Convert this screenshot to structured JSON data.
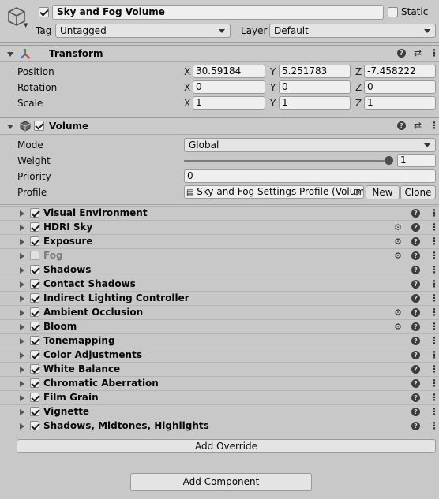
{
  "gameobject": {
    "active": true,
    "name": "Sky and Fog Volume",
    "static_label": "Static",
    "static_checked": false,
    "tag_label": "Tag",
    "tag_value": "Untagged",
    "layer_label": "Layer",
    "layer_value": "Default"
  },
  "transform": {
    "title": "Transform",
    "position_label": "Position",
    "rotation_label": "Rotation",
    "scale_label": "Scale",
    "axis_x": "X",
    "axis_y": "Y",
    "axis_z": "Z",
    "position": {
      "x": "30.59184",
      "y": "5.251783",
      "z": "-7.458222"
    },
    "rotation": {
      "x": "0",
      "y": "0",
      "z": "0"
    },
    "scale": {
      "x": "1",
      "y": "1",
      "z": "1"
    }
  },
  "volume": {
    "title": "Volume",
    "enabled": true,
    "mode_label": "Mode",
    "mode_value": "Global",
    "weight_label": "Weight",
    "weight_value": "1",
    "weight_fraction": 1.0,
    "priority_label": "Priority",
    "priority_value": "0",
    "profile_label": "Profile",
    "profile_value": "Sky and Fog Settings Profile (Volum",
    "new_button": "New",
    "clone_button": "Clone",
    "overrides": [
      {
        "label": "Visual Environment",
        "checked": true,
        "presets": false,
        "disabled": false
      },
      {
        "label": "HDRI Sky",
        "checked": true,
        "presets": true,
        "disabled": false
      },
      {
        "label": "Exposure",
        "checked": true,
        "presets": true,
        "disabled": false
      },
      {
        "label": "Fog",
        "checked": false,
        "presets": true,
        "disabled": true
      },
      {
        "label": "Shadows",
        "checked": true,
        "presets": false,
        "disabled": false
      },
      {
        "label": "Contact Shadows",
        "checked": true,
        "presets": false,
        "disabled": false
      },
      {
        "label": "Indirect Lighting Controller",
        "checked": true,
        "presets": false,
        "disabled": false
      },
      {
        "label": "Ambient Occlusion",
        "checked": true,
        "presets": true,
        "disabled": false
      },
      {
        "label": "Bloom",
        "checked": true,
        "presets": true,
        "disabled": false
      },
      {
        "label": "Tonemapping",
        "checked": true,
        "presets": false,
        "disabled": false
      },
      {
        "label": "Color Adjustments",
        "checked": true,
        "presets": false,
        "disabled": false
      },
      {
        "label": "White Balance",
        "checked": true,
        "presets": false,
        "disabled": false
      },
      {
        "label": "Chromatic Aberration",
        "checked": true,
        "presets": false,
        "disabled": false
      },
      {
        "label": "Film Grain",
        "checked": true,
        "presets": false,
        "disabled": false
      },
      {
        "label": "Vignette",
        "checked": true,
        "presets": false,
        "disabled": false
      },
      {
        "label": "Shadows, Midtones, Highlights",
        "checked": true,
        "presets": false,
        "disabled": false
      }
    ],
    "add_override_button": "Add Override"
  },
  "add_component_button": "Add Component",
  "icons": {
    "help": "?",
    "menu": "⋮",
    "presets": "⚙"
  }
}
